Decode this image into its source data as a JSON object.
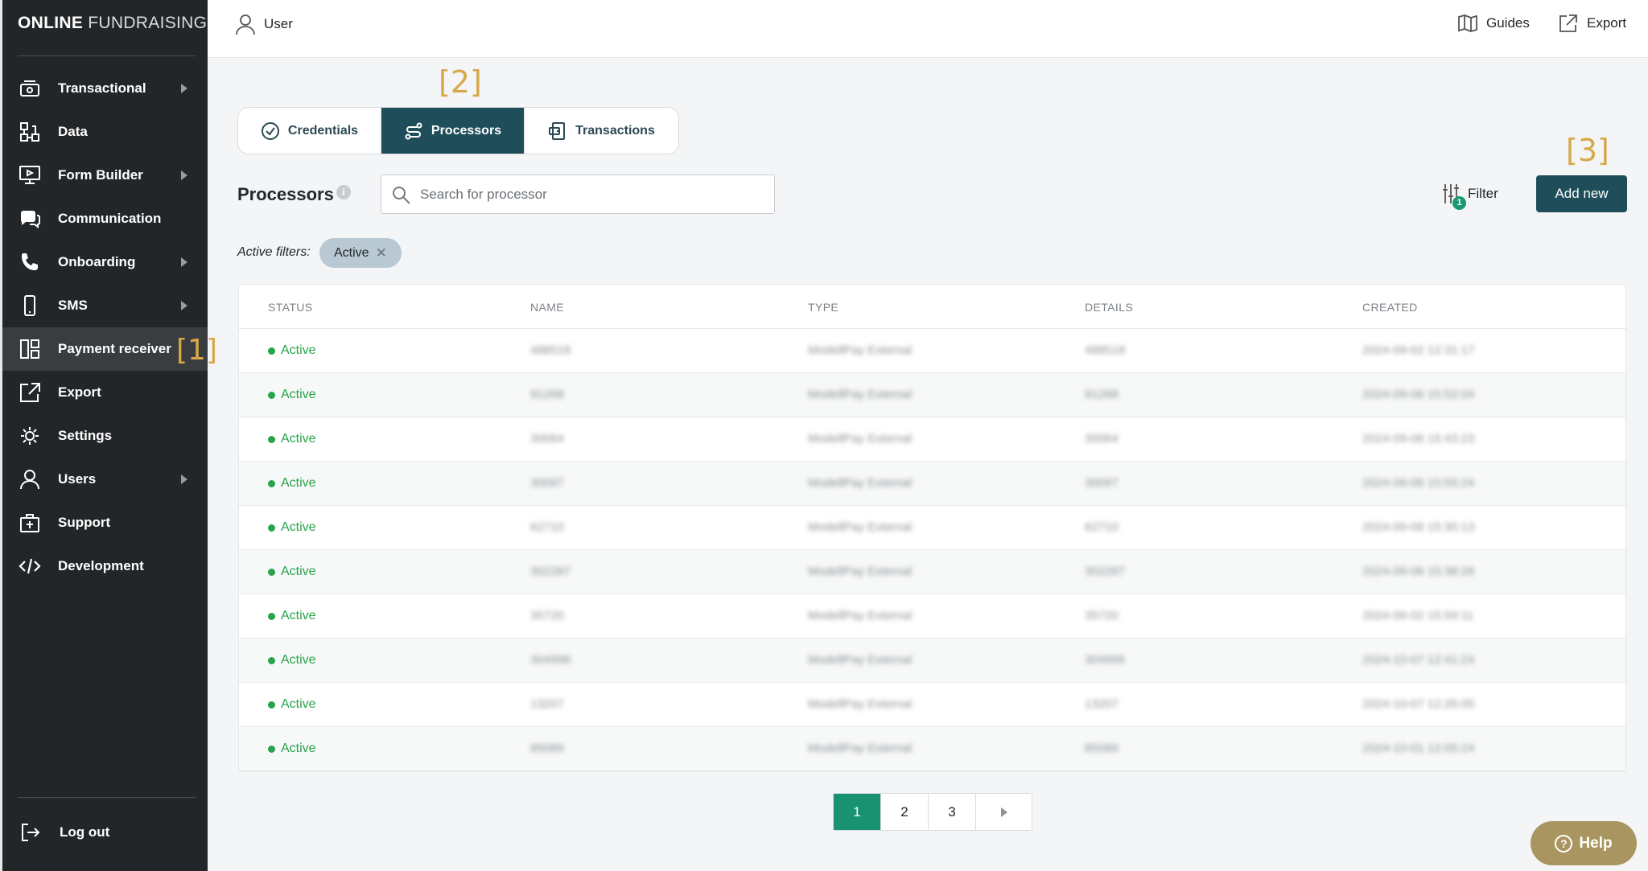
{
  "brand": {
    "bold": "ONLINE",
    "light": "FUNDRAISING"
  },
  "sidebar": {
    "items": [
      {
        "label": "Transactional",
        "icon": "cash-register-icon",
        "has_arrow": true
      },
      {
        "label": "Data",
        "icon": "data-nodes-icon",
        "has_arrow": false
      },
      {
        "label": "Form Builder",
        "icon": "monitor-play-icon",
        "has_arrow": true
      },
      {
        "label": "Communication",
        "icon": "chat-bubbles-icon",
        "has_arrow": false
      },
      {
        "label": "Onboarding",
        "icon": "phone-icon",
        "has_arrow": true
      },
      {
        "label": "SMS",
        "icon": "mobile-icon",
        "has_arrow": true
      },
      {
        "label": "Payment receiver",
        "icon": "layout-grid-icon",
        "has_arrow": false,
        "active": true,
        "marker": "[1]"
      },
      {
        "label": "Export",
        "icon": "export-icon",
        "has_arrow": false
      },
      {
        "label": "Settings",
        "icon": "gear-icon",
        "has_arrow": false
      },
      {
        "label": "Users",
        "icon": "user-icon",
        "has_arrow": true
      },
      {
        "label": "Support",
        "icon": "medkit-icon",
        "has_arrow": false
      },
      {
        "label": "Development",
        "icon": "code-icon",
        "has_arrow": false
      }
    ],
    "logout_label": "Log out"
  },
  "topbar": {
    "user_label": "User",
    "guides_label": "Guides",
    "export_label": "Export"
  },
  "tabs": {
    "marker": "[2]",
    "items": [
      {
        "label": "Credentials",
        "icon": "check-circle-icon"
      },
      {
        "label": "Processors",
        "icon": "route-icon",
        "active": true
      },
      {
        "label": "Transactions",
        "icon": "card-transfer-icon"
      }
    ]
  },
  "header": {
    "title": "Processors",
    "search_placeholder": "Search for processor",
    "filter_label": "Filter",
    "filter_count": "1",
    "add_new_label": "Add new",
    "add_new_marker": "[3]"
  },
  "active_filters": {
    "label": "Active filters:",
    "chip": "Active",
    "chip_close": "✕"
  },
  "table": {
    "columns": [
      "STATUS",
      "NAME",
      "TYPE",
      "DETAILS",
      "CREATED"
    ],
    "rows": [
      {
        "status": "Active",
        "name": "488518",
        "type": "ModellPay External",
        "details": "488518",
        "created": "2024-09-02 12:31:17"
      },
      {
        "status": "Active",
        "name": "91268",
        "type": "ModellPay External",
        "details": "91268",
        "created": "2024-09-06 15:52:04"
      },
      {
        "status": "Active",
        "name": "30064",
        "type": "ModellPay External",
        "details": "30064",
        "created": "2024-09-06 15:43:23"
      },
      {
        "status": "Active",
        "name": "30097",
        "type": "ModellPay External",
        "details": "30097",
        "created": "2024-09-06 15:55:24"
      },
      {
        "status": "Active",
        "name": "62710",
        "type": "ModellPay External",
        "details": "62710",
        "created": "2024-09-06 15:30:13"
      },
      {
        "status": "Active",
        "name": "302287",
        "type": "ModellPay External",
        "details": "302287",
        "created": "2024-09-06 15:38:26"
      },
      {
        "status": "Active",
        "name": "35720",
        "type": "ModellPay External",
        "details": "35720",
        "created": "2024-09-02 15:59:11"
      },
      {
        "status": "Active",
        "name": "304996",
        "type": "ModellPay External",
        "details": "304996",
        "created": "2024-10-07 12:41:24"
      },
      {
        "status": "Active",
        "name": "13207",
        "type": "ModellPay External",
        "details": "13207",
        "created": "2024-10-07 12:26:05"
      },
      {
        "status": "Active",
        "name": "85089",
        "type": "ModellPay External",
        "details": "85089",
        "created": "2024-10-01 12:05:24"
      }
    ]
  },
  "pagination": {
    "pages": [
      "1",
      "2",
      "3"
    ],
    "current": "1"
  },
  "help_label": "Help",
  "colors": {
    "sidebar_bg": "#232629",
    "accent": "#1f4e5a",
    "success": "#27a34c",
    "marker": "#d6a84a",
    "help": "#a99560"
  }
}
